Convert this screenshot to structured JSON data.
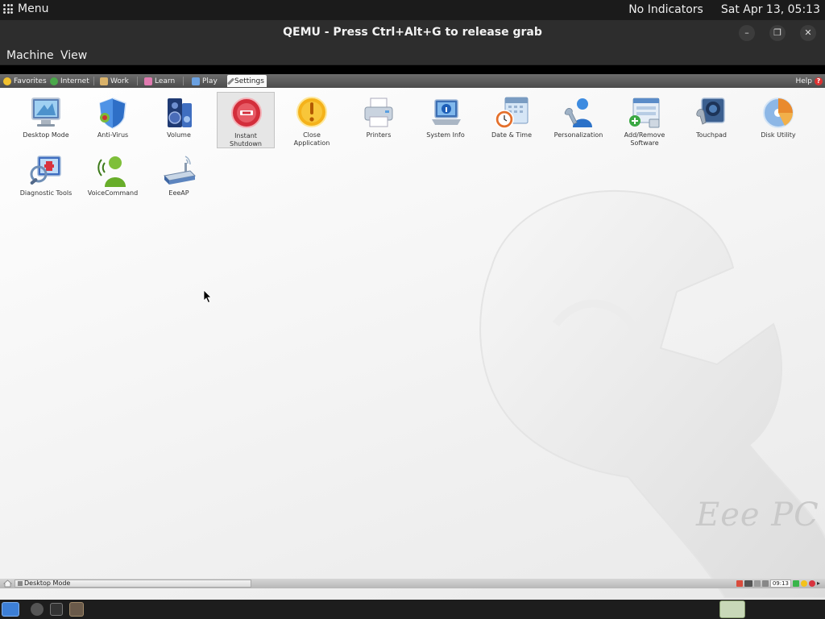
{
  "host": {
    "menu_label": "Menu",
    "indicators": "No Indicators",
    "clock": "Sat Apr 13, 05:13"
  },
  "qemu": {
    "title": "QEMU - Press Ctrl+Alt+G to release grab",
    "menus": [
      "Machine",
      "View"
    ]
  },
  "guest": {
    "tabs": [
      {
        "label": "Favorites",
        "icon": "star-icon",
        "color": "#f2c12e"
      },
      {
        "label": "Internet",
        "icon": "globe-icon",
        "color": "#4aa84a"
      },
      {
        "label": "Work",
        "icon": "briefcase-icon",
        "color": "#d9b26a"
      },
      {
        "label": "Learn",
        "icon": "book-icon",
        "color": "#e07ab0"
      },
      {
        "label": "Play",
        "icon": "joystick-icon",
        "color": "#6aa0e0"
      },
      {
        "label": "Settings",
        "icon": "wrench-icon",
        "color": "#888888"
      }
    ],
    "active_tab": "Settings",
    "help_label": "Help",
    "apps": [
      {
        "label": "Desktop Mode",
        "icon": "monitor-icon"
      },
      {
        "label": "Anti-Virus",
        "icon": "shield-icon"
      },
      {
        "label": "Volume",
        "icon": "speaker-icon"
      },
      {
        "label": "Instant\nShutdown",
        "icon": "power-icon"
      },
      {
        "label": "Close\nApplication",
        "icon": "warning-icon"
      },
      {
        "label": "Printers",
        "icon": "printer-icon"
      },
      {
        "label": "System Info",
        "icon": "info-laptop-icon"
      },
      {
        "label": "Date & Time",
        "icon": "calendar-clock-icon"
      },
      {
        "label": "Personalization",
        "icon": "user-icon"
      },
      {
        "label": "Add/Remove\nSoftware",
        "icon": "software-icon"
      },
      {
        "label": "Touchpad",
        "icon": "touchpad-icon"
      },
      {
        "label": "Disk Utility",
        "icon": "disk-icon"
      },
      {
        "label": "Diagnostic Tools",
        "icon": "diagnostic-icon"
      },
      {
        "label": "VoiceCommand",
        "icon": "voice-icon"
      },
      {
        "label": "EeeAP",
        "icon": "router-icon"
      }
    ],
    "selected_app": "Instant Shutdown",
    "brand": "Eee PC",
    "taskbar_item": "Desktop Mode",
    "tray_clock": "09:13"
  }
}
